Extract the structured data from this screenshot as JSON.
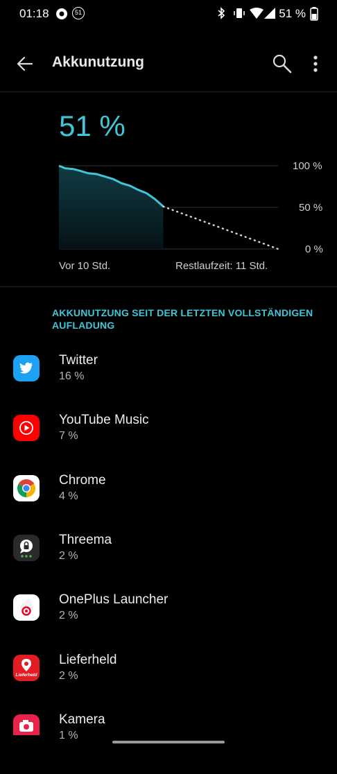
{
  "status": {
    "time": "01:18",
    "notif_badge": "51",
    "battery_pct": "51 %",
    "icons": [
      "circle-dot-icon",
      "badge-51-icon",
      "bluetooth-icon",
      "vibrate-icon",
      "wifi-icon",
      "signal-icon",
      "battery-icon"
    ]
  },
  "appbar": {
    "title": "Akkunutzung",
    "icons": [
      "back-arrow-icon",
      "search-icon",
      "more-vert-icon"
    ]
  },
  "battery": {
    "level": "51 %",
    "level_value": 51,
    "accent": "#3fc6d8",
    "chart_data": {
      "type": "line",
      "x_labels": {
        "start": "Vor 10 Std.",
        "end": "Restlaufzeit: 11 Std."
      },
      "y_ticks": [
        "100 %",
        "50 %",
        "0 %"
      ],
      "ylim": [
        0,
        100
      ],
      "history_hours": 10,
      "remaining_hours": 11,
      "series": [
        {
          "values_hours": [
            0,
            0.6,
            1.4,
            2,
            2.8,
            3.6,
            4.4,
            5.2,
            6,
            6.8,
            7.6,
            8.4,
            9.2,
            10
          ],
          "values": [
            100,
            97,
            96,
            94,
            91,
            90,
            87,
            84,
            79,
            76,
            71,
            67,
            60,
            51
          ]
        },
        {
          "style": "projection-dotted",
          "values_hours": [
            10,
            21
          ],
          "values": [
            51,
            0
          ]
        }
      ],
      "grid": true
    }
  },
  "section": {
    "header": "AKKUNUTZUNG SEIT DER LETZTEN VOLLSTÄNDIGEN AUFLADUNG"
  },
  "apps": [
    {
      "name": "Twitter",
      "pct": "16 %",
      "icon": "twitter-icon",
      "color": "#1da1f2"
    },
    {
      "name": "YouTube Music",
      "pct": "7 %",
      "icon": "youtube-music-icon",
      "color": "#ff0000"
    },
    {
      "name": "Chrome",
      "pct": "4 %",
      "icon": "chrome-icon",
      "color": "#ffffff"
    },
    {
      "name": "Threema",
      "pct": "2 %",
      "icon": "threema-icon",
      "color": "#2a2a2a"
    },
    {
      "name": "OnePlus Launcher",
      "pct": "2 %",
      "icon": "oneplus-launcher-icon",
      "color": "#ffffff"
    },
    {
      "name": "Lieferheld",
      "pct": "2 %",
      "icon": "lieferheld-icon",
      "color": "#e31b23",
      "icon_text": "Lieferheld"
    },
    {
      "name": "Kamera",
      "pct": "1 %",
      "icon": "camera-icon",
      "color": "#e8224a"
    }
  ]
}
